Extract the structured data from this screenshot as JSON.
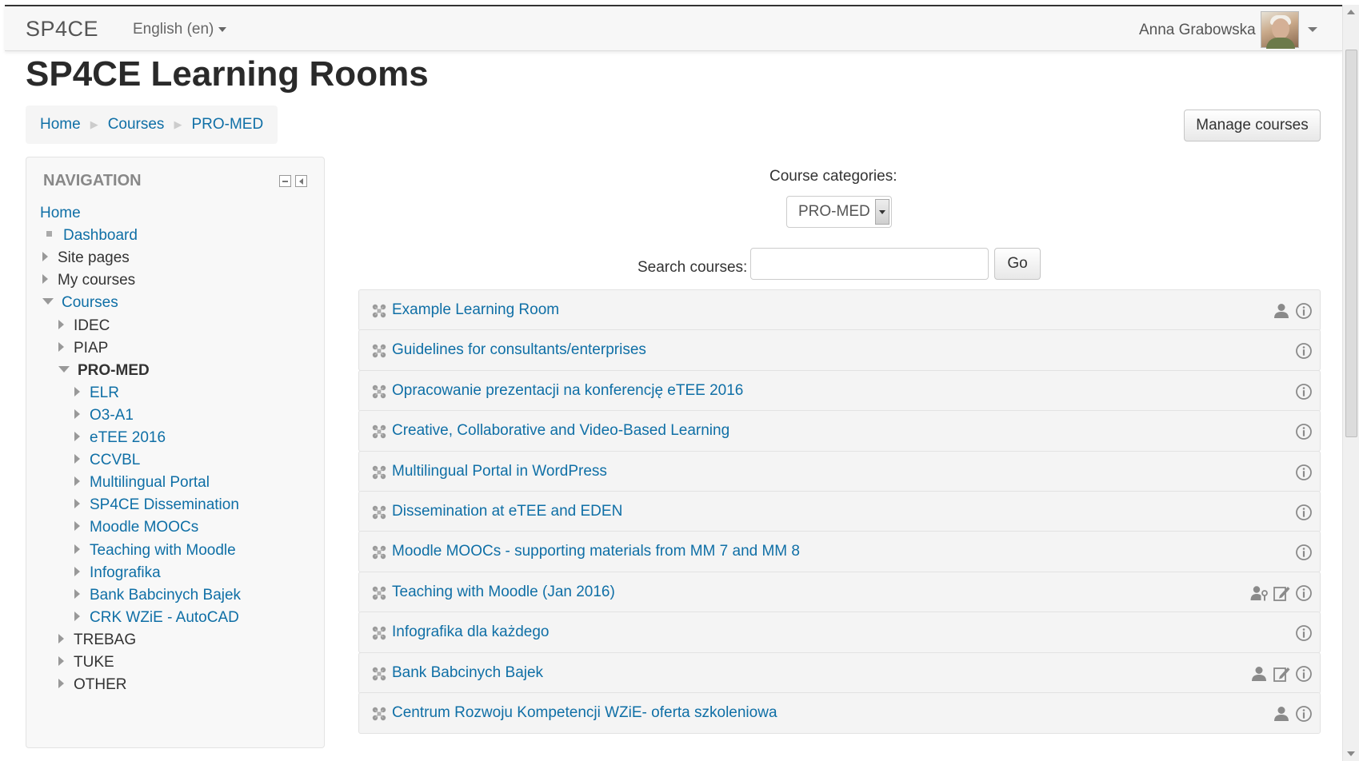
{
  "topbar": {
    "brand": "SP4CE",
    "language": "English (en)",
    "user_name": "Anna Grabowska"
  },
  "page": {
    "title": "SP4CE Learning Rooms",
    "manage_courses": "Manage courses"
  },
  "breadcrumb": [
    "Home",
    "Courses",
    "PRO-MED"
  ],
  "navigation": {
    "title": "NAVIGATION",
    "items": [
      {
        "label": "Home",
        "style": "link",
        "marker": "none",
        "level": 0
      },
      {
        "label": "Dashboard",
        "style": "link",
        "marker": "bullet",
        "level": 0
      },
      {
        "label": "Site pages",
        "style": "plain",
        "marker": "right",
        "level": 0
      },
      {
        "label": "My courses",
        "style": "plain",
        "marker": "right",
        "level": 0
      },
      {
        "label": "Courses",
        "style": "link",
        "marker": "down",
        "level": 0
      },
      {
        "label": "IDEC",
        "style": "plain",
        "marker": "right",
        "level": 1
      },
      {
        "label": "PIAP",
        "style": "plain",
        "marker": "right",
        "level": 1
      },
      {
        "label": "PRO-MED",
        "style": "bold",
        "marker": "down",
        "level": 1
      },
      {
        "label": "ELR",
        "style": "link",
        "marker": "right",
        "level": 2
      },
      {
        "label": "O3-A1",
        "style": "link",
        "marker": "right",
        "level": 2
      },
      {
        "label": "eTEE 2016",
        "style": "link",
        "marker": "right",
        "level": 2
      },
      {
        "label": "CCVBL",
        "style": "link",
        "marker": "right",
        "level": 2
      },
      {
        "label": "Multilingual Portal",
        "style": "link",
        "marker": "right",
        "level": 2
      },
      {
        "label": "SP4CE Dissemination",
        "style": "link",
        "marker": "right",
        "level": 2
      },
      {
        "label": "Moodle MOOCs",
        "style": "link",
        "marker": "right",
        "level": 2
      },
      {
        "label": "Teaching with Moodle",
        "style": "link",
        "marker": "right",
        "level": 2
      },
      {
        "label": "Infografika",
        "style": "link",
        "marker": "right",
        "level": 2
      },
      {
        "label": "Bank Babcinych Bajek",
        "style": "link",
        "marker": "right",
        "level": 2
      },
      {
        "label": "CRK WZiE - AutoCAD",
        "style": "link",
        "marker": "right",
        "level": 2
      },
      {
        "label": "TREBAG",
        "style": "plain",
        "marker": "right",
        "level": 1
      },
      {
        "label": "TUKE",
        "style": "plain",
        "marker": "right",
        "level": 1
      },
      {
        "label": "OTHER",
        "style": "plain",
        "marker": "right",
        "level": 1
      }
    ]
  },
  "filters": {
    "categories_label": "Course categories:",
    "category_selected": "PRO-MED",
    "search_label": "Search courses:",
    "search_value": "",
    "go_label": "Go"
  },
  "courses": [
    {
      "name": "Example Learning Room",
      "actions": [
        "user-icon",
        "info-icon"
      ]
    },
    {
      "name": "Guidelines for consultants/enterprises",
      "actions": [
        "info-icon"
      ]
    },
    {
      "name": "Opracowanie prezentacji na konferencję eTEE 2016",
      "actions": [
        "info-icon"
      ]
    },
    {
      "name": "Creative, Collaborative and Video-Based Learning",
      "actions": [
        "info-icon"
      ]
    },
    {
      "name": "Multilingual Portal in WordPress",
      "actions": [
        "info-icon"
      ]
    },
    {
      "name": "Dissemination at eTEE and EDEN",
      "actions": [
        "info-icon"
      ]
    },
    {
      "name": "Moodle MOOCs - supporting materials from MM 7 and MM 8",
      "actions": [
        "info-icon"
      ]
    },
    {
      "name": "Teaching with Moodle (Jan 2016)",
      "actions": [
        "guest-key-icon",
        "self-enrol-icon",
        "info-icon"
      ]
    },
    {
      "name": "Infografika dla każdego",
      "actions": [
        "info-icon"
      ]
    },
    {
      "name": "Bank Babcinych Bajek",
      "actions": [
        "user-icon",
        "self-enrol-icon",
        "info-icon"
      ]
    },
    {
      "name": "Centrum Rozwoju Kompetencji WZiE- oferta szkoleniowa",
      "actions": [
        "user-icon",
        "info-icon"
      ]
    }
  ],
  "colors": {
    "link": "#0f6fa6",
    "row_bg": "#f4f4f4",
    "icon_gray": "#8a8a8a"
  }
}
